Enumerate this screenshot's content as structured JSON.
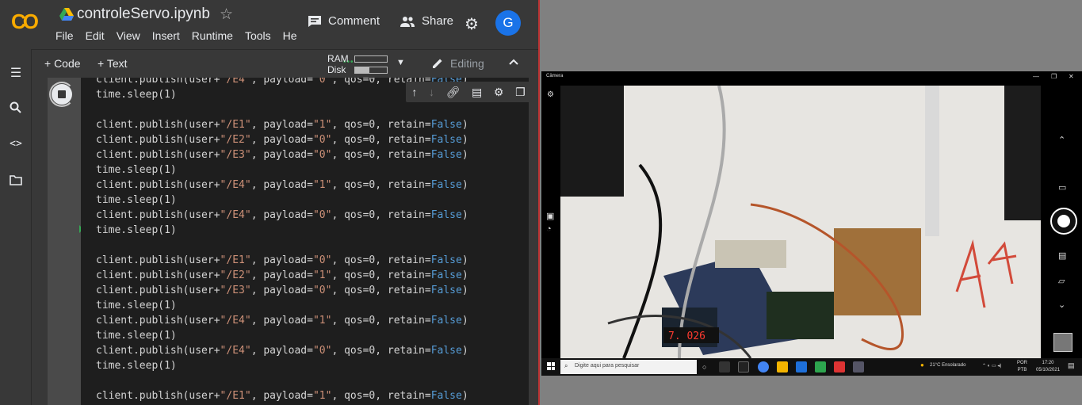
{
  "colab": {
    "notebook_title": "controleServo.ipynb",
    "menu": [
      "File",
      "Edit",
      "View",
      "Insert",
      "Runtime",
      "Tools",
      "He"
    ],
    "comment_label": "Comment",
    "share_label": "Share",
    "avatar_letter": "G",
    "add_code_label": "+ Code",
    "add_text_label": "+ Text",
    "ram_label": "RAM",
    "disk_label": "Disk",
    "ram_usage": 0.0,
    "disk_usage": 0.45,
    "editing_label": "Editing",
    "logo_text": "CO",
    "code_lines": [
      {
        "user": "/E4",
        "payload": "0",
        "partial": true
      },
      {
        "sleep": "time.sleep(1)"
      },
      {
        "blank": true
      },
      {
        "user": "/E1",
        "payload": "1"
      },
      {
        "user": "/E2",
        "payload": "0"
      },
      {
        "user": "/E3",
        "payload": "0"
      },
      {
        "sleep": "time.sleep(1)"
      },
      {
        "user": "/E4",
        "payload": "1"
      },
      {
        "sleep": "time.sleep(1)"
      },
      {
        "user": "/E4",
        "payload": "0"
      },
      {
        "sleep": "time.sleep(1)"
      },
      {
        "blank": true
      },
      {
        "user": "/E1",
        "payload": "0"
      },
      {
        "user": "/E2",
        "payload": "1"
      },
      {
        "user": "/E3",
        "payload": "0"
      },
      {
        "sleep": "time.sleep(1)"
      },
      {
        "user": "/E4",
        "payload": "1"
      },
      {
        "sleep": "time.sleep(1)"
      },
      {
        "user": "/E4",
        "payload": "0"
      },
      {
        "sleep": "time.sleep(1)"
      },
      {
        "blank": true
      },
      {
        "user": "/E1",
        "payload": "1"
      }
    ],
    "qos": "0",
    "retain": "False"
  },
  "camera": {
    "window_title": "Câmera",
    "display_digits": "7. 026",
    "taskbar_search_placeholder": "Digite aqui para pesquisar",
    "weather": "21°C  Ensolarado",
    "language_top": "POR",
    "language_bottom": "PTB",
    "time": "17:20",
    "date": "05/10/2021"
  },
  "colors": {
    "colab_bg": "#383838",
    "editor_bg": "#1e1e1e",
    "keyword_blue": "#569cd6",
    "string_orange": "#ce9178",
    "accent_blue": "#1a73e8",
    "colab_orange": "#f9ab00"
  }
}
